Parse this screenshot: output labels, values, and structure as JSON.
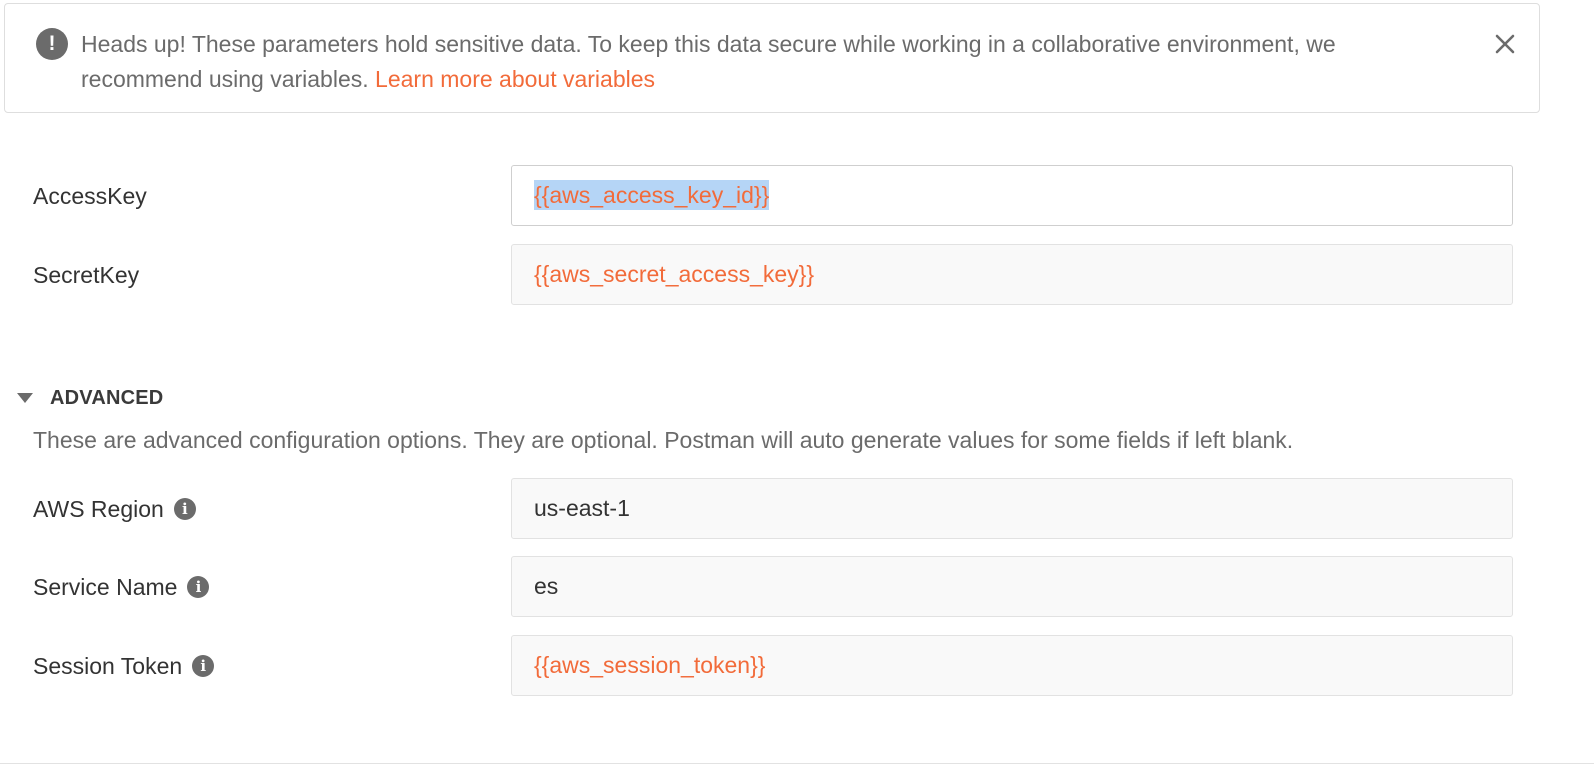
{
  "banner": {
    "icon": "exclamation-circle-icon",
    "icon_glyph": "!",
    "message": "Heads up! These parameters hold sensitive data. To keep this data secure while working in a collaborative environment, we recommend using variables.",
    "link_text": "Learn more about variables",
    "close_icon": "close-icon"
  },
  "fields": {
    "access_key": {
      "label": "AccessKey",
      "value": "{{aws_access_key_id}}"
    },
    "secret_key": {
      "label": "SecretKey",
      "value": "{{aws_secret_access_key}}"
    }
  },
  "advanced": {
    "title": "ADVANCED",
    "toggle_icon": "caret-down-icon",
    "description": "These are advanced configuration options. They are optional. Postman will auto generate values for some fields if left blank.",
    "info_glyph": "i",
    "fields": {
      "region": {
        "label": "AWS Region",
        "value": "us-east-1"
      },
      "service_name": {
        "label": "Service Name",
        "value": "es"
      },
      "session_token": {
        "label": "Session Token",
        "value": "{{aws_session_token}}"
      }
    }
  },
  "colors": {
    "accent": "#f26b3a",
    "selection": "#b5d5f6",
    "icon_gray": "#6b6b6b",
    "input_bg": "#f9f9f9",
    "border": "#e2e2e2"
  }
}
